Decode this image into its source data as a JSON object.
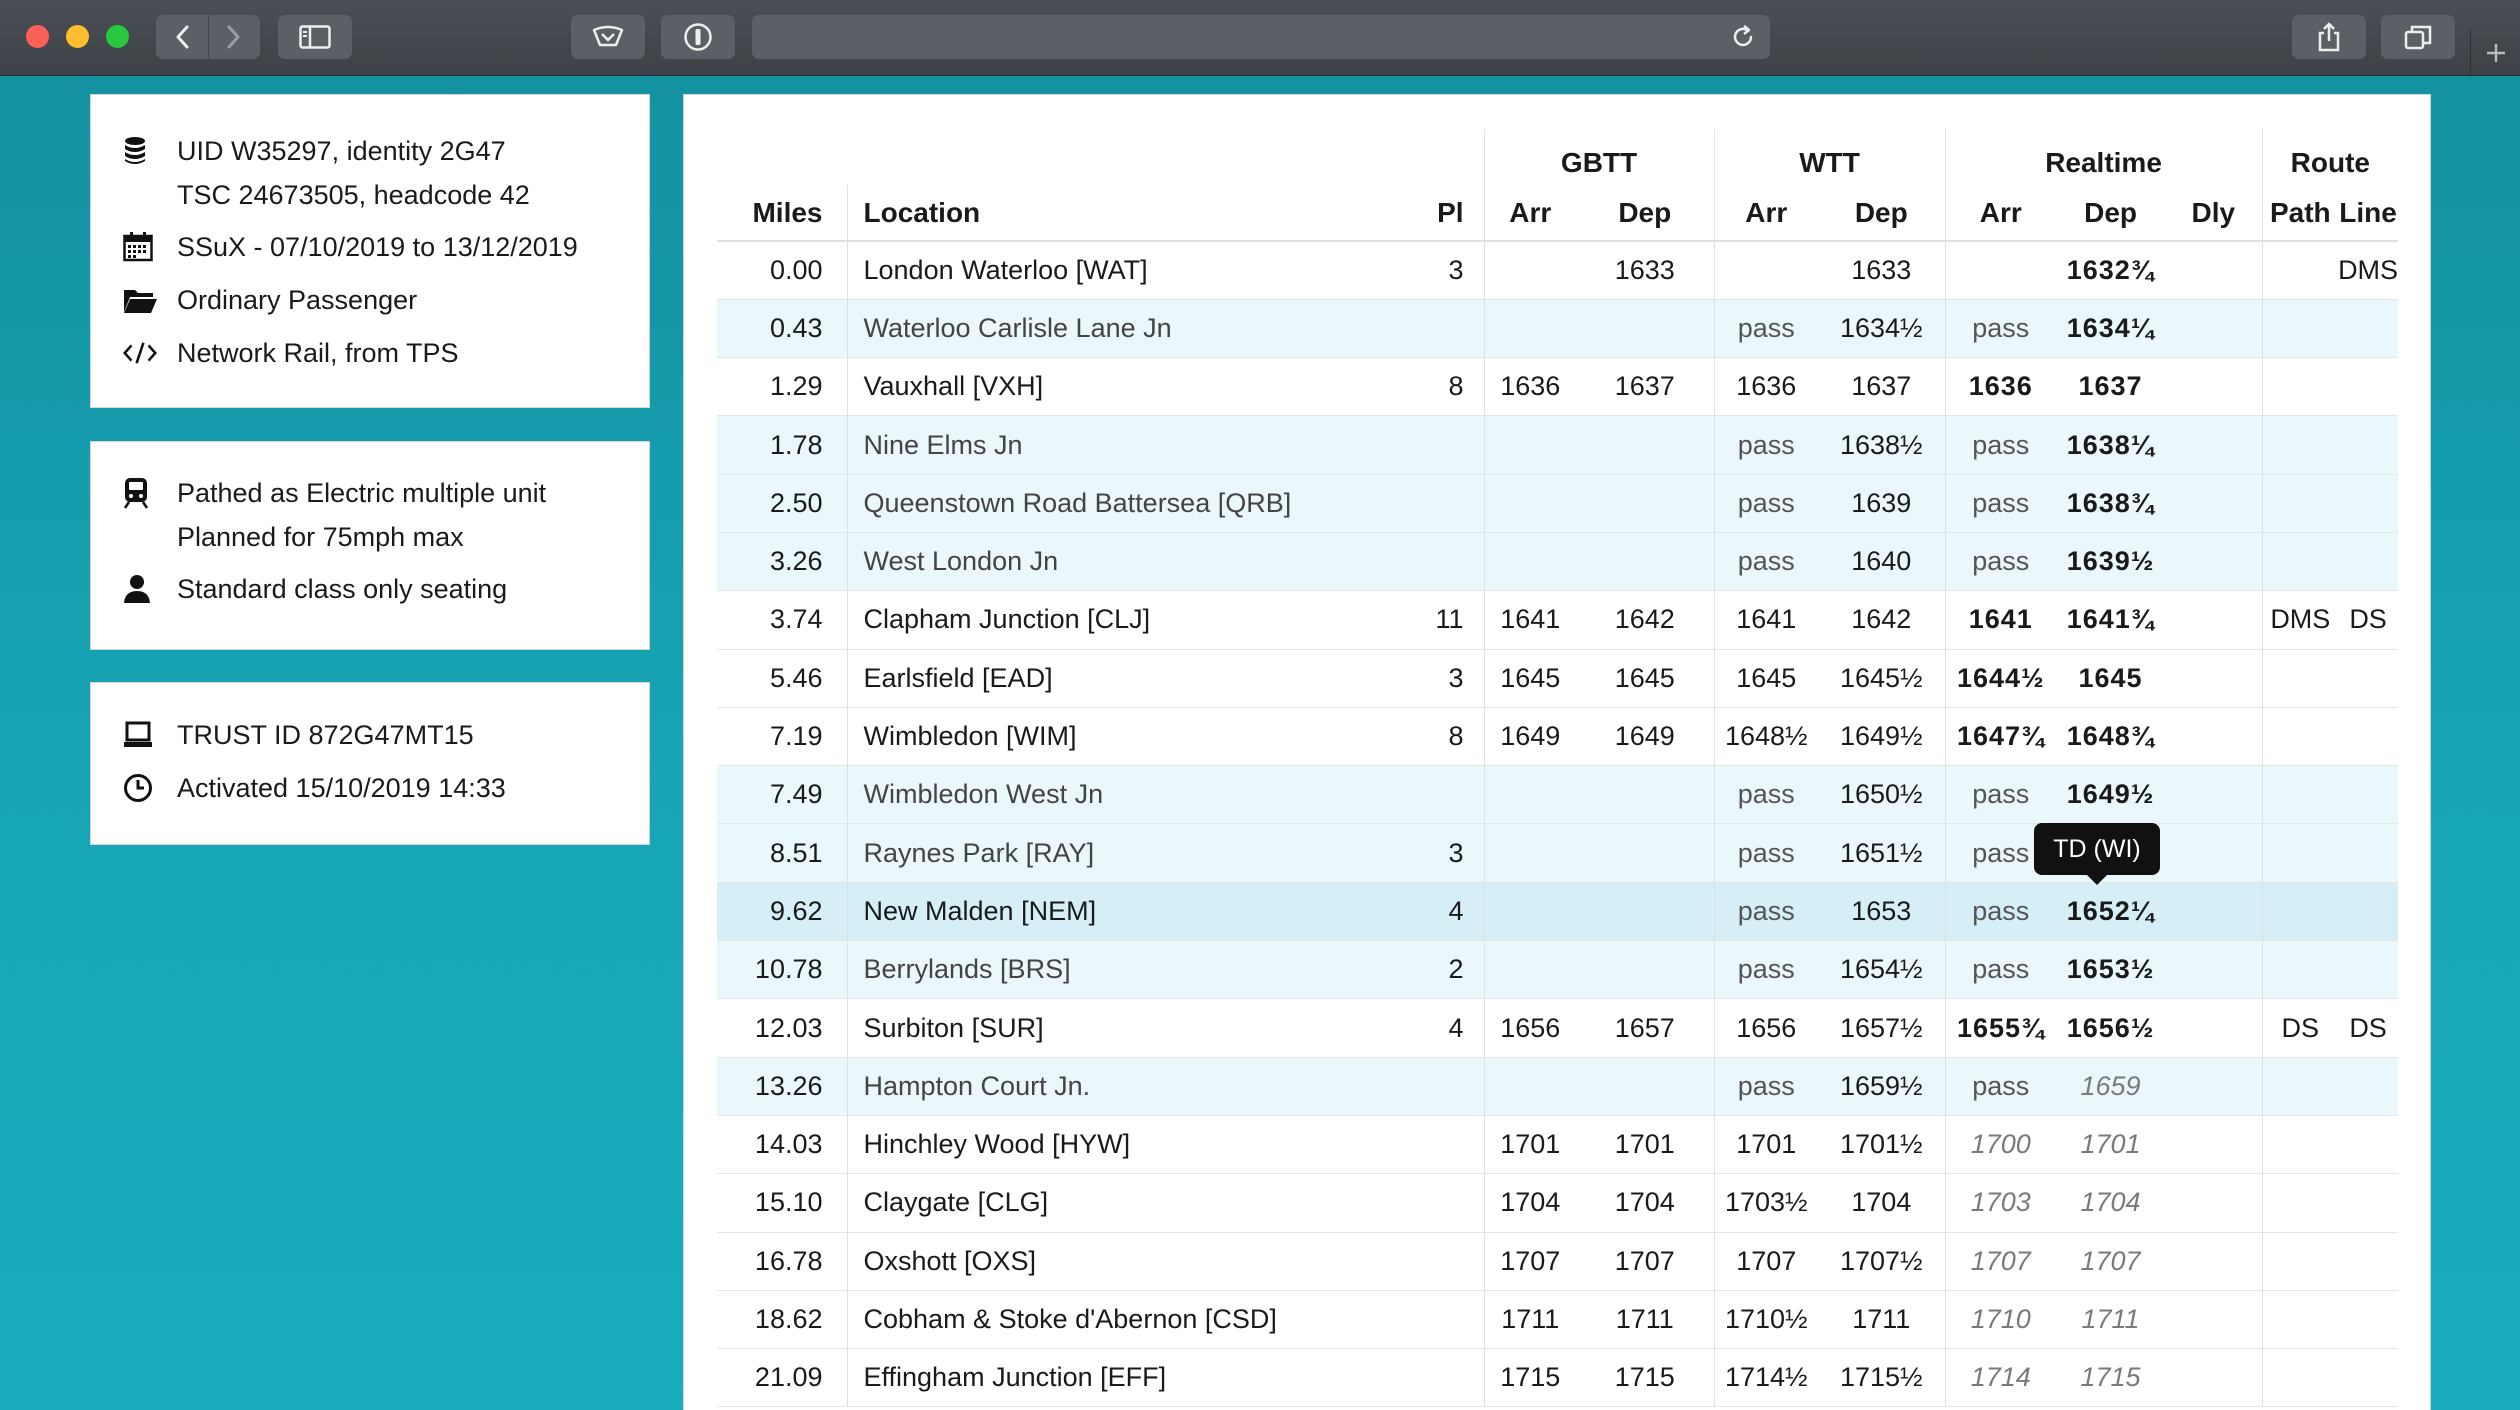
{
  "info": {
    "uid": "UID W35297, identity 2G47",
    "tsc": "TSC 24673505, headcode 42",
    "schedule": "SSuX - 07/10/2019 to 13/12/2019",
    "category": "Ordinary Passenger",
    "source": "Network Rail, from TPS",
    "pathed": "Pathed as Electric multiple unit",
    "planned": "Planned for 75mph max",
    "seating": "Standard class only seating",
    "trust_id": "TRUST ID 872G47MT15",
    "activated": "Activated 15/10/2019 14:33"
  },
  "table": {
    "group_headers": {
      "gbtt": "GBTT",
      "wtt": "WTT",
      "realtime": "Realtime",
      "route": "Route"
    },
    "headers": {
      "miles": "Miles",
      "location": "Location",
      "pl": "Pl",
      "gbtt_arr": "Arr",
      "gbtt_dep": "Dep",
      "wtt_arr": "Arr",
      "wtt_dep": "Dep",
      "rt_arr": "Arr",
      "rt_dep": "Dep",
      "dly": "Dly",
      "path": "Path",
      "line": "Line"
    },
    "rows": [
      {
        "miles": "0.00",
        "location": "London Waterloo [WAT]",
        "pl": "3",
        "gbtt_arr": "",
        "gbtt_dep": "1633",
        "wtt_arr": "",
        "wtt_dep": "1633",
        "rt_arr": "",
        "rt_dep": "1632¾",
        "dly": "",
        "path": "",
        "line": "DMS",
        "style": "",
        "rt_style": "rt"
      },
      {
        "miles": "0.43",
        "location": "Waterloo Carlisle Lane Jn",
        "pl": "",
        "gbtt_arr": "",
        "gbtt_dep": "",
        "wtt_arr": "pass",
        "wtt_dep": "1634½",
        "rt_arr": "pass",
        "rt_dep": "1634¼",
        "dly": "",
        "path": "",
        "line": "",
        "style": "alt",
        "rt_style": "rt"
      },
      {
        "miles": "1.29",
        "location": "Vauxhall [VXH]",
        "pl": "8",
        "gbtt_arr": "1636",
        "gbtt_dep": "1637",
        "wtt_arr": "1636",
        "wtt_dep": "1637",
        "rt_arr": "1636",
        "rt_dep": "1637",
        "dly": "",
        "path": "",
        "line": "",
        "style": "",
        "rt_style": "rt"
      },
      {
        "miles": "1.78",
        "location": "Nine Elms Jn",
        "pl": "",
        "gbtt_arr": "",
        "gbtt_dep": "",
        "wtt_arr": "pass",
        "wtt_dep": "1638½",
        "rt_arr": "pass",
        "rt_dep": "1638¼",
        "dly": "",
        "path": "",
        "line": "",
        "style": "alt",
        "rt_style": "rt"
      },
      {
        "miles": "2.50",
        "location": "Queenstown Road Battersea [QRB]",
        "pl": "",
        "gbtt_arr": "",
        "gbtt_dep": "",
        "wtt_arr": "pass",
        "wtt_dep": "1639",
        "rt_arr": "pass",
        "rt_dep": "1638¾",
        "dly": "",
        "path": "",
        "line": "",
        "style": "alt",
        "rt_style": "rt"
      },
      {
        "miles": "3.26",
        "location": "West London Jn",
        "pl": "",
        "gbtt_arr": "",
        "gbtt_dep": "",
        "wtt_arr": "pass",
        "wtt_dep": "1640",
        "rt_arr": "pass",
        "rt_dep": "1639½",
        "dly": "",
        "path": "",
        "line": "",
        "style": "alt",
        "rt_style": "rt"
      },
      {
        "miles": "3.74",
        "location": "Clapham Junction [CLJ]",
        "pl": "11",
        "gbtt_arr": "1641",
        "gbtt_dep": "1642",
        "wtt_arr": "1641",
        "wtt_dep": "1642",
        "rt_arr": "1641",
        "rt_dep": "1641¾",
        "dly": "",
        "path": "DMS",
        "line": "DS",
        "style": "",
        "rt_style": "rt"
      },
      {
        "miles": "5.46",
        "location": "Earlsfield [EAD]",
        "pl": "3",
        "gbtt_arr": "1645",
        "gbtt_dep": "1645",
        "wtt_arr": "1645",
        "wtt_dep": "1645½",
        "rt_arr": "1644½",
        "rt_dep": "1645",
        "dly": "",
        "path": "",
        "line": "",
        "style": "",
        "rt_style": "rt"
      },
      {
        "miles": "7.19",
        "location": "Wimbledon [WIM]",
        "pl": "8",
        "gbtt_arr": "1649",
        "gbtt_dep": "1649",
        "wtt_arr": "1648½",
        "wtt_dep": "1649½",
        "rt_arr": "1647¾",
        "rt_dep": "1648¾",
        "dly": "",
        "path": "",
        "line": "",
        "style": "",
        "rt_style": "rt"
      },
      {
        "miles": "7.49",
        "location": "Wimbledon West Jn",
        "pl": "",
        "gbtt_arr": "",
        "gbtt_dep": "",
        "wtt_arr": "pass",
        "wtt_dep": "1650½",
        "rt_arr": "pass",
        "rt_dep": "1649½",
        "dly": "",
        "path": "",
        "line": "",
        "style": "alt",
        "rt_style": "rt"
      },
      {
        "miles": "8.51",
        "location": "Raynes Park [RAY]",
        "pl": "3",
        "gbtt_arr": "",
        "gbtt_dep": "",
        "wtt_arr": "pass",
        "wtt_dep": "1651½",
        "rt_arr": "pass",
        "rt_dep": "",
        "dly": "",
        "path": "",
        "line": "",
        "style": "alt",
        "rt_style": "rt"
      },
      {
        "miles": "9.62",
        "location": "New Malden [NEM]",
        "pl": "4",
        "gbtt_arr": "",
        "gbtt_dep": "",
        "wtt_arr": "pass",
        "wtt_dep": "1653",
        "rt_arr": "pass",
        "rt_dep": "1652¼",
        "dly": "",
        "path": "",
        "line": "",
        "style": "hl",
        "rt_style": "rt"
      },
      {
        "miles": "10.78",
        "location": "Berrylands [BRS]",
        "pl": "2",
        "gbtt_arr": "",
        "gbtt_dep": "",
        "wtt_arr": "pass",
        "wtt_dep": "1654½",
        "rt_arr": "pass",
        "rt_dep": "1653½",
        "dly": "",
        "path": "",
        "line": "",
        "style": "alt",
        "rt_style": "rt"
      },
      {
        "miles": "12.03",
        "location": "Surbiton [SUR]",
        "pl": "4",
        "gbtt_arr": "1656",
        "gbtt_dep": "1657",
        "wtt_arr": "1656",
        "wtt_dep": "1657½",
        "rt_arr": "1655¾",
        "rt_dep": "1656½",
        "dly": "",
        "path": "DS",
        "line": "DS",
        "style": "",
        "rt_style": "rt"
      },
      {
        "miles": "13.26",
        "location": "Hampton Court Jn.",
        "pl": "",
        "gbtt_arr": "",
        "gbtt_dep": "",
        "wtt_arr": "pass",
        "wtt_dep": "1659½",
        "rt_arr": "pass",
        "rt_dep": "1659",
        "dly": "",
        "path": "",
        "line": "",
        "style": "alt",
        "rt_style": "pred"
      },
      {
        "miles": "14.03",
        "location": "Hinchley Wood [HYW]",
        "pl": "",
        "gbtt_arr": "1701",
        "gbtt_dep": "1701",
        "wtt_arr": "1701",
        "wtt_dep": "1701½",
        "rt_arr": "1700",
        "rt_dep": "1701",
        "dly": "",
        "path": "",
        "line": "",
        "style": "",
        "rt_style": "pred"
      },
      {
        "miles": "15.10",
        "location": "Claygate [CLG]",
        "pl": "",
        "gbtt_arr": "1704",
        "gbtt_dep": "1704",
        "wtt_arr": "1703½",
        "wtt_dep": "1704",
        "rt_arr": "1703",
        "rt_dep": "1704",
        "dly": "",
        "path": "",
        "line": "",
        "style": "",
        "rt_style": "pred"
      },
      {
        "miles": "16.78",
        "location": "Oxshott [OXS]",
        "pl": "",
        "gbtt_arr": "1707",
        "gbtt_dep": "1707",
        "wtt_arr": "1707",
        "wtt_dep": "1707½",
        "rt_arr": "1707",
        "rt_dep": "1707",
        "dly": "",
        "path": "",
        "line": "",
        "style": "",
        "rt_style": "pred"
      },
      {
        "miles": "18.62",
        "location": "Cobham & Stoke d'Abernon [CSD]",
        "pl": "",
        "gbtt_arr": "1711",
        "gbtt_dep": "1711",
        "wtt_arr": "1710½",
        "wtt_dep": "1711",
        "rt_arr": "1710",
        "rt_dep": "1711",
        "dly": "",
        "path": "",
        "line": "",
        "style": "",
        "rt_style": "pred"
      },
      {
        "miles": "21.09",
        "location": "Effingham Junction [EFF]",
        "pl": "",
        "gbtt_arr": "1715",
        "gbtt_dep": "1715",
        "wtt_arr": "1714½",
        "wtt_dep": "1715½",
        "rt_arr": "1714",
        "rt_dep": "1715",
        "dly": "",
        "path": "",
        "line": "",
        "style": "",
        "rt_style": "pred"
      }
    ]
  },
  "tooltip": {
    "text": "TD (WI)"
  },
  "colors": {
    "background": "#17a6b6",
    "titlebar": "#3f4449",
    "row_alt": "#eaf7fb",
    "row_highlight": "#d6eff6"
  }
}
